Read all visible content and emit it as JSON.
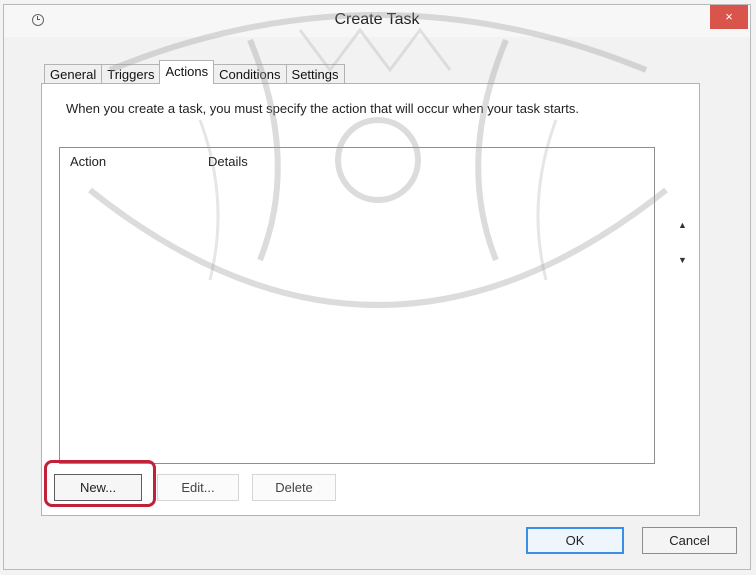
{
  "window": {
    "title": "Create Task",
    "close_glyph": "×"
  },
  "tabs": [
    {
      "label": "General",
      "selected": false
    },
    {
      "label": "Triggers",
      "selected": false
    },
    {
      "label": "Actions",
      "selected": true
    },
    {
      "label": "Conditions",
      "selected": false
    },
    {
      "label": "Settings",
      "selected": false
    }
  ],
  "actions_panel": {
    "instruction": "When you create a task, you must specify the action that will occur when your task starts.",
    "columns": [
      "Action",
      "Details"
    ],
    "rows": [],
    "scroll_up_glyph": "▲",
    "scroll_down_glyph": "▼",
    "buttons": {
      "new": "New...",
      "edit": "Edit...",
      "delete": "Delete"
    }
  },
  "footer": {
    "ok": "OK",
    "cancel": "Cancel"
  },
  "colors": {
    "highlight": "#c2213a",
    "close_button": "#d9544b",
    "default_button_border": "#3a8ee6"
  }
}
